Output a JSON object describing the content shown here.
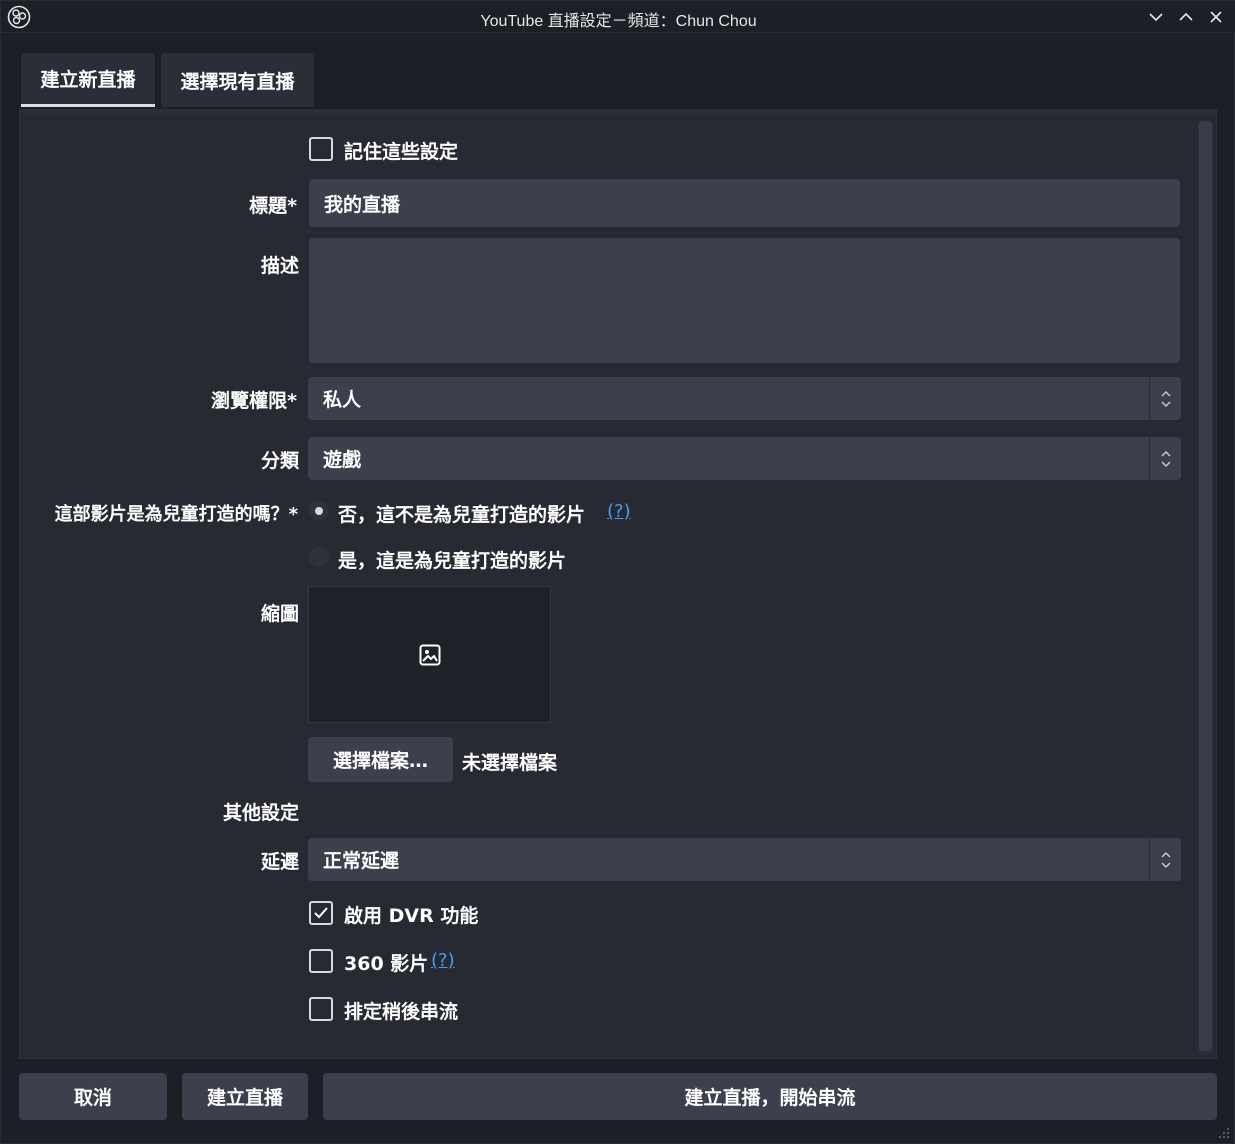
{
  "window": {
    "title": "YouTube 直播設定－頻道：Chun Chou"
  },
  "tabs": [
    {
      "label": "建立新直播",
      "active": true
    },
    {
      "label": "選擇現有直播",
      "active": false
    }
  ],
  "form": {
    "remember": {
      "label": "記住這些設定",
      "checked": false
    },
    "title": {
      "label": "標題*",
      "value": "我的直播"
    },
    "description": {
      "label": "描述",
      "value": ""
    },
    "privacy": {
      "label": "瀏覽權限*",
      "value": "私人"
    },
    "category": {
      "label": "分類",
      "value": "遊戲"
    },
    "made_for_kids": {
      "label": "這部影片是為兒童打造的嗎？*",
      "option_no": "否，這不是為兒童打造的影片",
      "option_yes": "是，這是為兒童打造的影片",
      "selected": "no",
      "help": "(?)"
    },
    "thumbnail": {
      "label": "縮圖",
      "select_button": "選擇檔案…",
      "status": "未選擇檔案"
    },
    "other_settings": {
      "heading": "其他設定"
    },
    "latency": {
      "label": "延遲",
      "value": "正常延遲"
    },
    "dvr": {
      "label": "啟用 DVR 功能",
      "checked": true
    },
    "video360": {
      "label": "360 影片",
      "checked": false,
      "help": "(?)"
    },
    "schedule": {
      "label": "排定稍後串流",
      "checked": false
    }
  },
  "buttons": {
    "cancel": "取消",
    "create": "建立直播",
    "create_and_start": "建立直播，開始串流"
  },
  "colors": {
    "background": "#1d1f26",
    "panel": "#272a33",
    "input": "#3c404d",
    "link": "#4b9cf1"
  }
}
